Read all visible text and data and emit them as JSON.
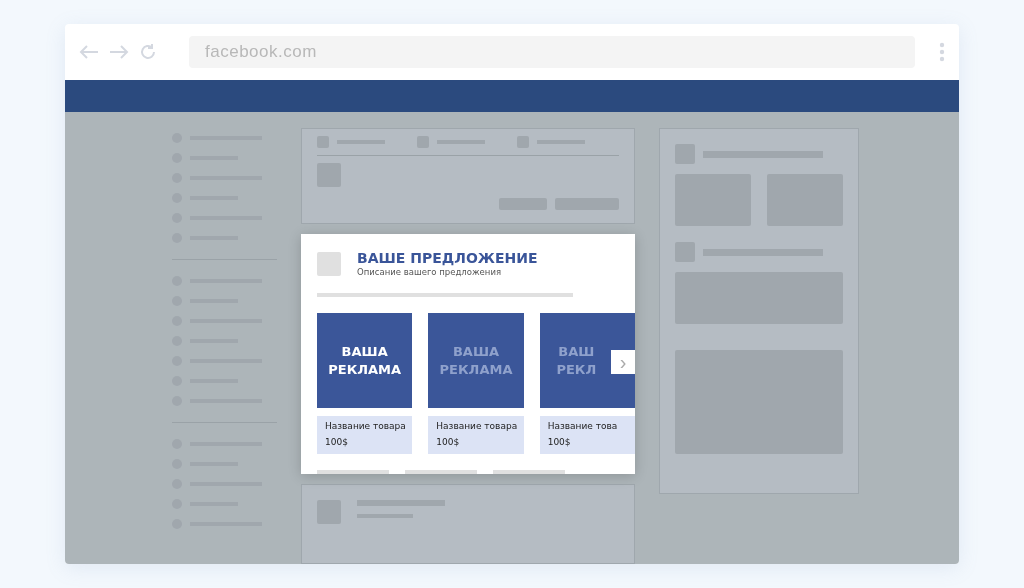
{
  "browser": {
    "address": "facebook.com"
  },
  "ad": {
    "title": "ВАШЕ ПРЕДЛОЖЕНИЕ",
    "subtitle": "Описание вашего предложения",
    "products": [
      {
        "image_lines": [
          "ВАША",
          "РЕКЛАМА"
        ],
        "name": "Название товара",
        "price": "100$",
        "dimmed": false
      },
      {
        "image_lines": [
          "ВАША",
          "РЕКЛАМА"
        ],
        "name": "Название товара",
        "price": "100$",
        "dimmed": true
      },
      {
        "image_lines": [
          "ВАШ",
          "РЕКЛ"
        ],
        "name": "Название това",
        "price": "100$",
        "dimmed": true
      }
    ],
    "next_icon": "›"
  }
}
